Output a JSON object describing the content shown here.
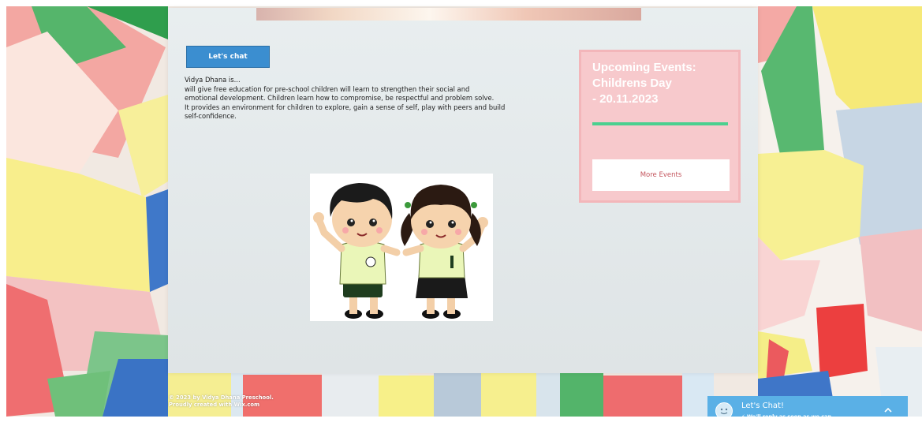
{
  "content": {
    "chat_button_label": "Let's chat",
    "intro_heading": "Vidya Dhana is...",
    "intro_lines": [
      "will give free education for pre-school children will learn to strengthen their social and",
      "emotional development. Children learn how to compromise, be respectful and problem solve.",
      "It provides an environment for children to explore, gain a sense of self, play with peers and build",
      "self-confidence."
    ],
    "kids_image_icon": "two-cartoon-schoolchildren"
  },
  "events": {
    "title_lines": [
      "Upcoming Events:",
      "Childrens Day",
      "- 20.11.2023"
    ],
    "more_button_label": "More Events",
    "accent_color": "#4bd08f"
  },
  "footer": {
    "lines": [
      "© 2023 by Vidya Dhana Preschool.",
      "Proudly created with Wix.com"
    ]
  },
  "chat_widget": {
    "title": "Let's Chat!",
    "subtitle": "We'll reply as soon as we can",
    "icons": [
      "avatar-icon",
      "lightning-icon",
      "chevron-up-icon"
    ],
    "color": "#5ab0e6"
  }
}
